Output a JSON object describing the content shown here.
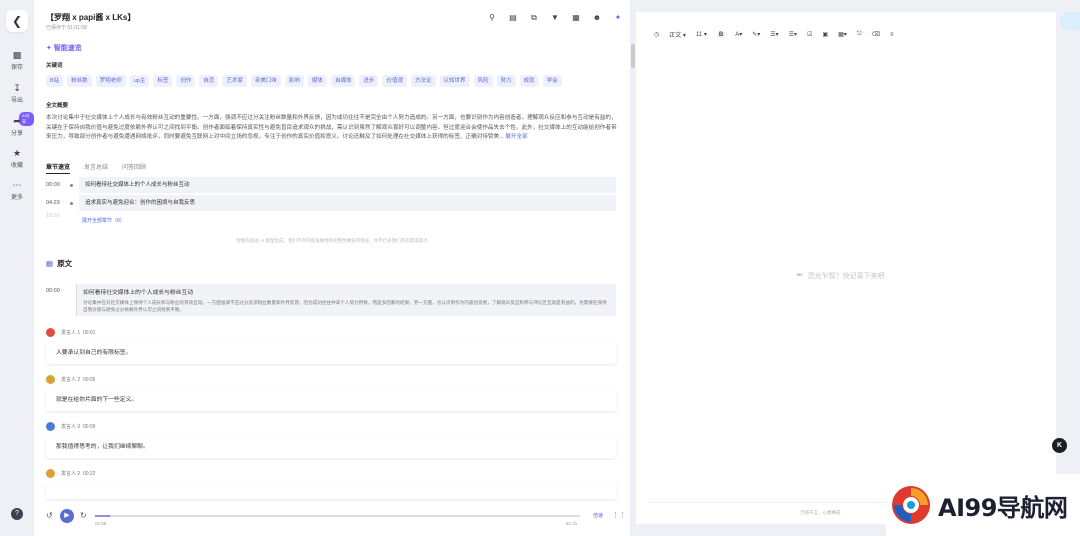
{
  "header": {
    "title": "【罗翔 x papi酱 x LKs】",
    "subtitle": "已保存于 01:01:08"
  },
  "rail": {
    "items": [
      {
        "label": "保存",
        "icon": "save-icon"
      },
      {
        "label": "导出",
        "icon": "export-icon"
      },
      {
        "label": "分享",
        "icon": "share-icon"
      },
      {
        "label": "收藏",
        "icon": "star-icon"
      },
      {
        "label": "更多",
        "icon": "more-icon"
      }
    ],
    "badge": "AI分享"
  },
  "smart": {
    "title": "智能速览",
    "keywords_label": "关键词",
    "keywords": [
      "B站",
      "粉丝数",
      "罗翔老师",
      "up主",
      "标签",
      "创作",
      "自恋",
      "艺术家",
      "亲美口味",
      "影响",
      "媒体",
      "自媒体",
      "进步",
      "价值观",
      "方法论",
      "认知世界",
      "风险",
      "努力",
      "成就",
      "学会"
    ],
    "summary_label": "全文概要",
    "summary": "本次讨论集中于社交媒体上个人成长与有效粉丝互动的重要性。一方面，强调不应过分关注粉丝数量和外界反馈，因为成功往往不是完全由个人努力造成的。另一方面，也要识别作为内容创造者，理解观众反应和参与互动是有益的，关键在于保持自我价值与避免过度依赖外界认可之间找到平衡。创作者面临着保持真实性与避免盲目追求观众的挑战，需认识到虽然了解观众喜好可以调整内容，但过度迎合会使作品失去个性。此外，社交媒体上的互动能给创作者带来压力，导致部分创作者与避免遭遇网络批评，同时要避免互联网上对中间立场的忽视，专注于创作的真实价值和意义。讨论还触及了如何处理在社交媒体上获得的标签、正确对待赞美...",
    "summary_more": "展开全部"
  },
  "tabs": [
    "章节速览",
    "发言总结",
    "问答回顾"
  ],
  "chapters": [
    {
      "time": "00:00",
      "text": "如何看待社交媒体上的个人成长与粉丝互动"
    },
    {
      "time": "04:29",
      "text": "追求真实与避免迎合：创作的困境与自我反思"
    },
    {
      "time": "10:55",
      "text": ""
    }
  ],
  "expand_chapters": "展开全部章节（8）",
  "disclaimer": "智能内容由 AI 模型生成，我们不对内容准确性和完整性做任何保证，亦不代表我们的态度或观点",
  "original": {
    "title": "原文",
    "para_time": "00:00",
    "para_title": "如何看待社交媒体上的个人成长与粉丝互动",
    "para_body": "讨论集中在对社交媒体上保持个人成长和与粉丝的有效互动。一方面强调不应过分追求粉丝数量和外界反馈，因为成功往往并非个人努力所致，而是多因素的结果。另一方面，也认识到作为内容创造者，了解观众反应和参与评论区互动是有益的，也需要在保持自我价值与避免过分依赖外界认可之间找到平衡。",
    "entries": [
      {
        "speaker": "发言人 1",
        "time": "00:01",
        "text": "人要承认到自己的有限标签。",
        "color": "#e05040"
      },
      {
        "speaker": "发言人 2",
        "time": "00:05",
        "text": "就是在给你片面的下一些定义。",
        "color": "#d9a13a"
      },
      {
        "speaker": "发言人 3",
        "time": "00:09",
        "text": "那我值得思考的，让我们继续聊聊。",
        "color": "#4a7cd6"
      },
      {
        "speaker": "发言人 2",
        "time": "00:22",
        "text": "",
        "color": "#d9a13a"
      }
    ]
  },
  "player": {
    "current": "01:56",
    "total": "61:31",
    "progress": 0.031,
    "speed": "倍速"
  },
  "editor": {
    "style": "正文",
    "size": "11",
    "placeholder": "灵光乍现？快记录下来吧",
    "footer": "万语千言，心想事成"
  },
  "watermark": "AI99导航网",
  "float_button": "K"
}
